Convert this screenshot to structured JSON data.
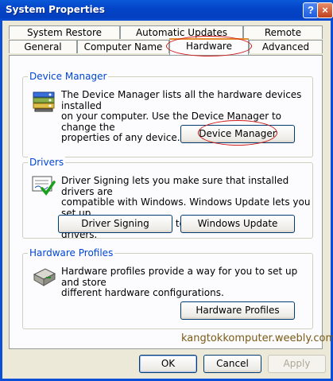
{
  "window": {
    "title": "System Properties"
  },
  "titlebar": {
    "help_glyph": "?",
    "close_glyph": "×"
  },
  "tabs": {
    "system_restore": "System Restore",
    "automatic_updates": "Automatic Updates",
    "remote": "Remote",
    "general": "General",
    "computer_name": "Computer Name",
    "hardware": "Hardware",
    "advanced": "Advanced"
  },
  "device_manager": {
    "heading": "Device Manager",
    "description": [
      "The Device Manager lists all the hardware devices installed",
      "on your computer. Use the Device Manager to change the",
      "properties of any device."
    ],
    "button": "Device Manager",
    "icon": "device-manager-icon"
  },
  "drivers": {
    "heading": "Drivers",
    "description": [
      "Driver Signing lets you make sure that installed drivers are",
      "compatible with Windows. Windows Update lets you set up",
      "how Windows connects to Windows Update for drivers."
    ],
    "signing_button": "Driver Signing",
    "update_button": "Windows Update",
    "icon": "driver-signing-icon"
  },
  "hardware_profiles": {
    "heading": "Hardware Profiles",
    "description": [
      "Hardware profiles provide a way for you to set up and store",
      "different hardware configurations."
    ],
    "button": "Hardware Profiles",
    "icon": "hardware-profiles-icon"
  },
  "watermark": "kangtokkomputer.weebly.com",
  "footer": {
    "ok": "OK",
    "cancel": "Cancel",
    "apply": "Apply"
  },
  "colors": {
    "title_bar": "#0a4fd6",
    "dialog_bg": "#ece9d8",
    "group_heading": "#0046d5",
    "annotation": "#d01818"
  }
}
